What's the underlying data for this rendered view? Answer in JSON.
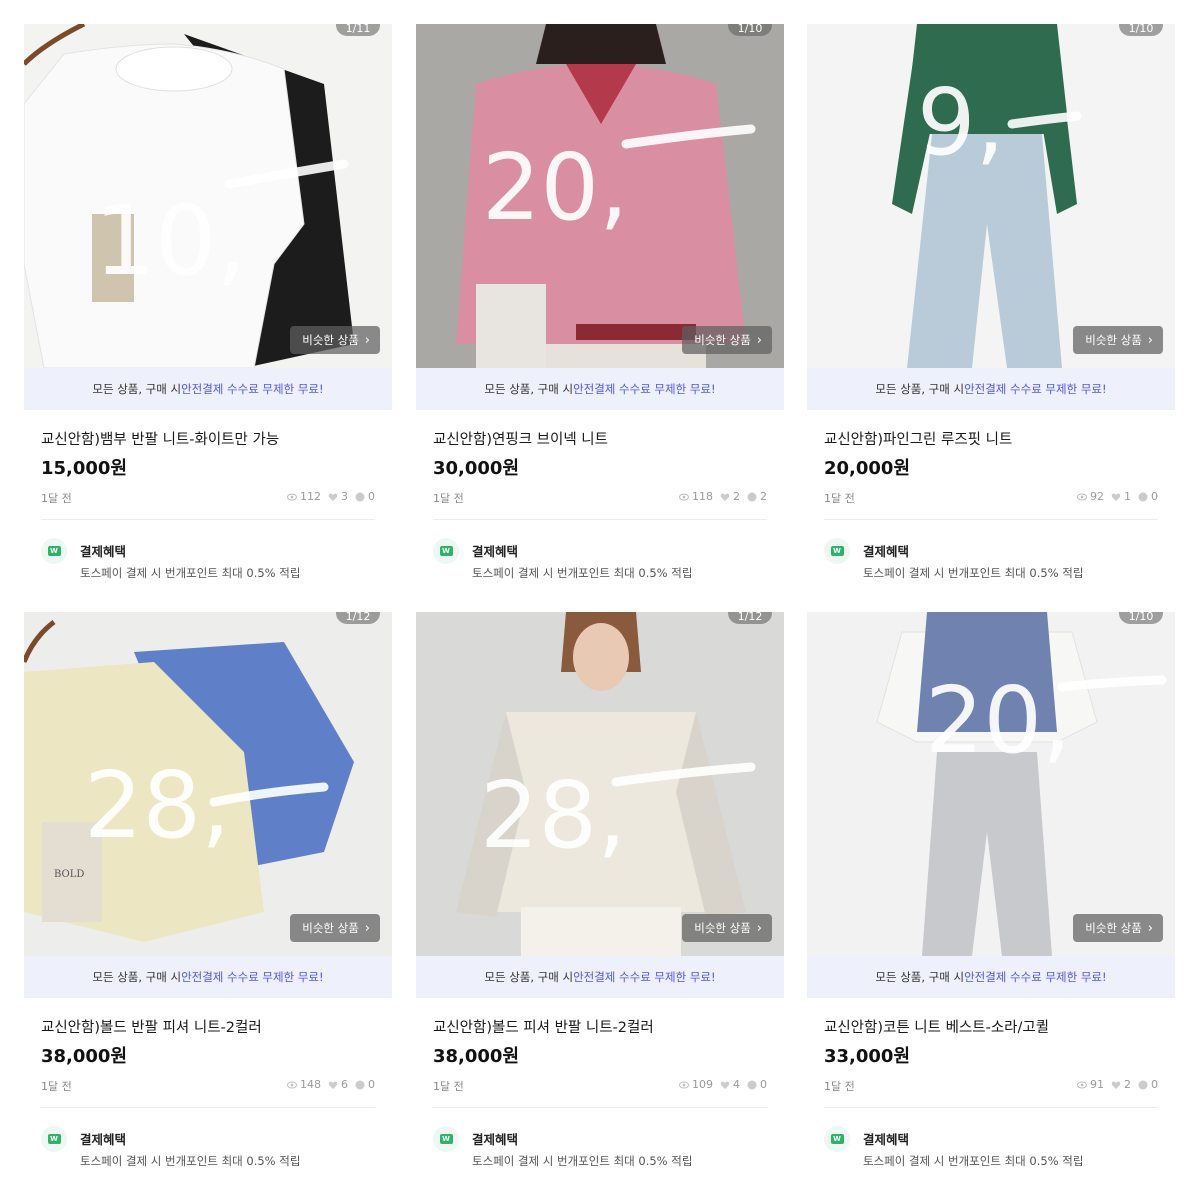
{
  "common": {
    "similar_label": "비슷한 상품",
    "banner_prefix": "모든 상품, 구매 시 ",
    "banner_highlight": "안전결제 수수료 무제한 무료!",
    "benefit_title": "결제혜택",
    "benefit_desc": "토스페이 결제 시 번개포인트 최대 0.5% 적립",
    "age": "1달 전",
    "colors": {
      "banner_bg": "#eef0fb",
      "highlight": "#4f58e0",
      "pay_green": "#2fb36b"
    }
  },
  "products": [
    {
      "title": "교신안함)뱀부 반팔 니트-화이트만 가능",
      "price": "15,000원",
      "counter": "1/11",
      "scrawl": "10,",
      "views": "112",
      "likes": "3",
      "chats": "0"
    },
    {
      "title": "교신안함)연핑크 브이넥 니트",
      "price": "30,000원",
      "counter": "1/10",
      "scrawl": "20,",
      "views": "118",
      "likes": "2",
      "chats": "2"
    },
    {
      "title": "교신안함)파인그린 루즈핏 니트",
      "price": "20,000원",
      "counter": "1/10",
      "scrawl": "9,",
      "views": "92",
      "likes": "1",
      "chats": "0"
    },
    {
      "title": "교신안함)볼드 반팔 피셔 니트-2컬러",
      "price": "38,000원",
      "counter": "1/12",
      "scrawl": "28,",
      "views": "148",
      "likes": "6",
      "chats": "0"
    },
    {
      "title": "교신안함)볼드 피셔 반팔 니트-2컬러",
      "price": "38,000원",
      "counter": "1/12",
      "scrawl": "28,",
      "views": "109",
      "likes": "4",
      "chats": "0"
    },
    {
      "title": "교신안함)코튼 니트 베스트-소라/고퀼",
      "price": "33,000원",
      "counter": "1/10",
      "scrawl": "20,",
      "views": "91",
      "likes": "2",
      "chats": "0"
    }
  ]
}
